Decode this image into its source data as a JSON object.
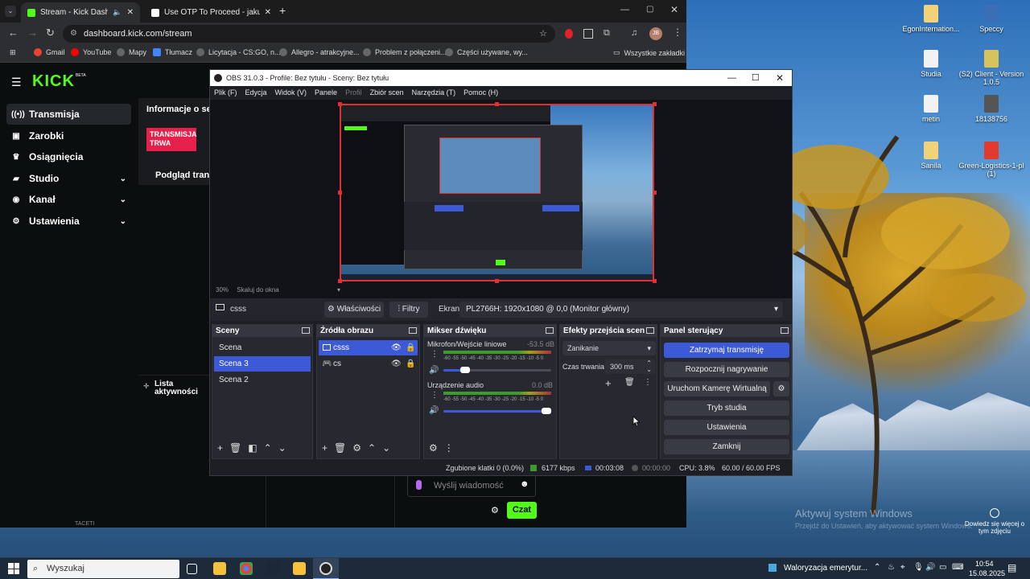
{
  "browser": {
    "tabs": [
      {
        "title": "Stream - Kick Dashboard"
      },
      {
        "title": "Use OTP To Proceed - jakubmis"
      }
    ],
    "url": "dashboard.kick.com/stream",
    "profile_initials": "JB",
    "bookmarks": [
      "Gmail",
      "YouTube",
      "Mapy",
      "Tłumacz",
      "Licytacja - CS:GO, n...",
      "Allegro - atrakcyjne...",
      "Problem z połączeni...",
      "Części używane, wy..."
    ],
    "all_bookmarks": "Wszystkie zakładki"
  },
  "kick": {
    "logo": "KICK",
    "logo_badge": "BETA",
    "nav": [
      {
        "label": "Transmisja",
        "icon": "broadcast-icon"
      },
      {
        "label": "Zarobki",
        "icon": "wallet-icon"
      },
      {
        "label": "Osiągnięcia",
        "icon": "trophy-icon"
      },
      {
        "label": "Studio",
        "icon": "studio-icon"
      },
      {
        "label": "Kanał",
        "icon": "user-icon"
      },
      {
        "label": "Ustawienia",
        "icon": "gear-icon"
      }
    ],
    "info_title": "Informacje o se",
    "live_badge": "TRANSMISJA TRWA",
    "preview_title": "Podgląd transm",
    "activity_title": "Lista aktywności",
    "chat_placeholder": "Wyślij wiadomość",
    "chat_button": "Czat",
    "bottom_text": "TACETI"
  },
  "obs": {
    "title": "OBS 31.0.3 - Profile: Bez tytułu - Sceny: Bez tytułu",
    "menu": [
      "Plik (F)",
      "Edycja",
      "Widok (V)",
      "Panele",
      "Profil",
      "Zbiór scen",
      "Narzędzia (T)",
      "Pomoc (H)"
    ],
    "zoom": "30%",
    "zoom_mode": "Skaluj do okna",
    "selected_source": "csss",
    "properties": "Właściwości",
    "filters": "Filtry",
    "screen_label": "Ekran",
    "monitor": "PL2766H: 1920x1080 @ 0,0 (Monitor główny)",
    "scenes": {
      "title": "Sceny",
      "items": [
        "Scena",
        "Scena 3",
        "Scena 2"
      ],
      "selected": "Scena 3"
    },
    "sources": {
      "title": "Źródła obrazu",
      "items": [
        "csss",
        "cs"
      ]
    },
    "mixer": {
      "title": "Mikser dźwięku",
      "channels": [
        {
          "name": "Mikrofon/Wejście liniowe",
          "db": "-53.5 dB",
          "level": 0.2
        },
        {
          "name": "Urządzenie audio",
          "db": "0.0 dB",
          "level": 1.0
        }
      ],
      "scale": "-60 -55 -50 -45 -40 -35 -30 -25 -20 -15 -10 -5 0"
    },
    "transitions": {
      "title": "Efekty przejścia scen",
      "type": "Zanikanie",
      "duration_label": "Czas trwania",
      "duration": "300 ms"
    },
    "controls": {
      "title": "Panel sterujący",
      "buttons": [
        "Zatrzymaj transmisję",
        "Rozpocznij nagrywanie",
        "Uruchom Kamerę Wirtualną",
        "Tryb studia",
        "Ustawienia",
        "Zamknij"
      ]
    },
    "status": {
      "dropped": "Zgubione klatki 0 (0.0%)",
      "bitrate": "6177 kbps",
      "live_time": "00:03:08",
      "rec_time": "00:00:00",
      "cpu": "CPU: 3.8%",
      "fps": "60.00 / 60.00 FPS"
    }
  },
  "desktop": {
    "icons": [
      {
        "label": "EgonInternation..."
      },
      {
        "label": "Speccy"
      },
      {
        "label": "Studia"
      },
      {
        "label": "(S2) Client - Version 1.0.5"
      },
      {
        "label": "metin"
      },
      {
        "label": "18138756"
      },
      {
        "label": "Sanila"
      },
      {
        "label": "Green-Logistics-1-pl (1)"
      }
    ],
    "activate_title": "Aktywuj system Windows",
    "activate_sub": "Przejdź do Ustawień, aby aktywować system Windows.",
    "learn_more": "Dowiedz się więcej o tym zdjęciu"
  },
  "taskbar": {
    "search": "Wyszukaj",
    "news": "Waloryzacja emerytur...",
    "time": "10:54",
    "date": "15.08.2025"
  }
}
